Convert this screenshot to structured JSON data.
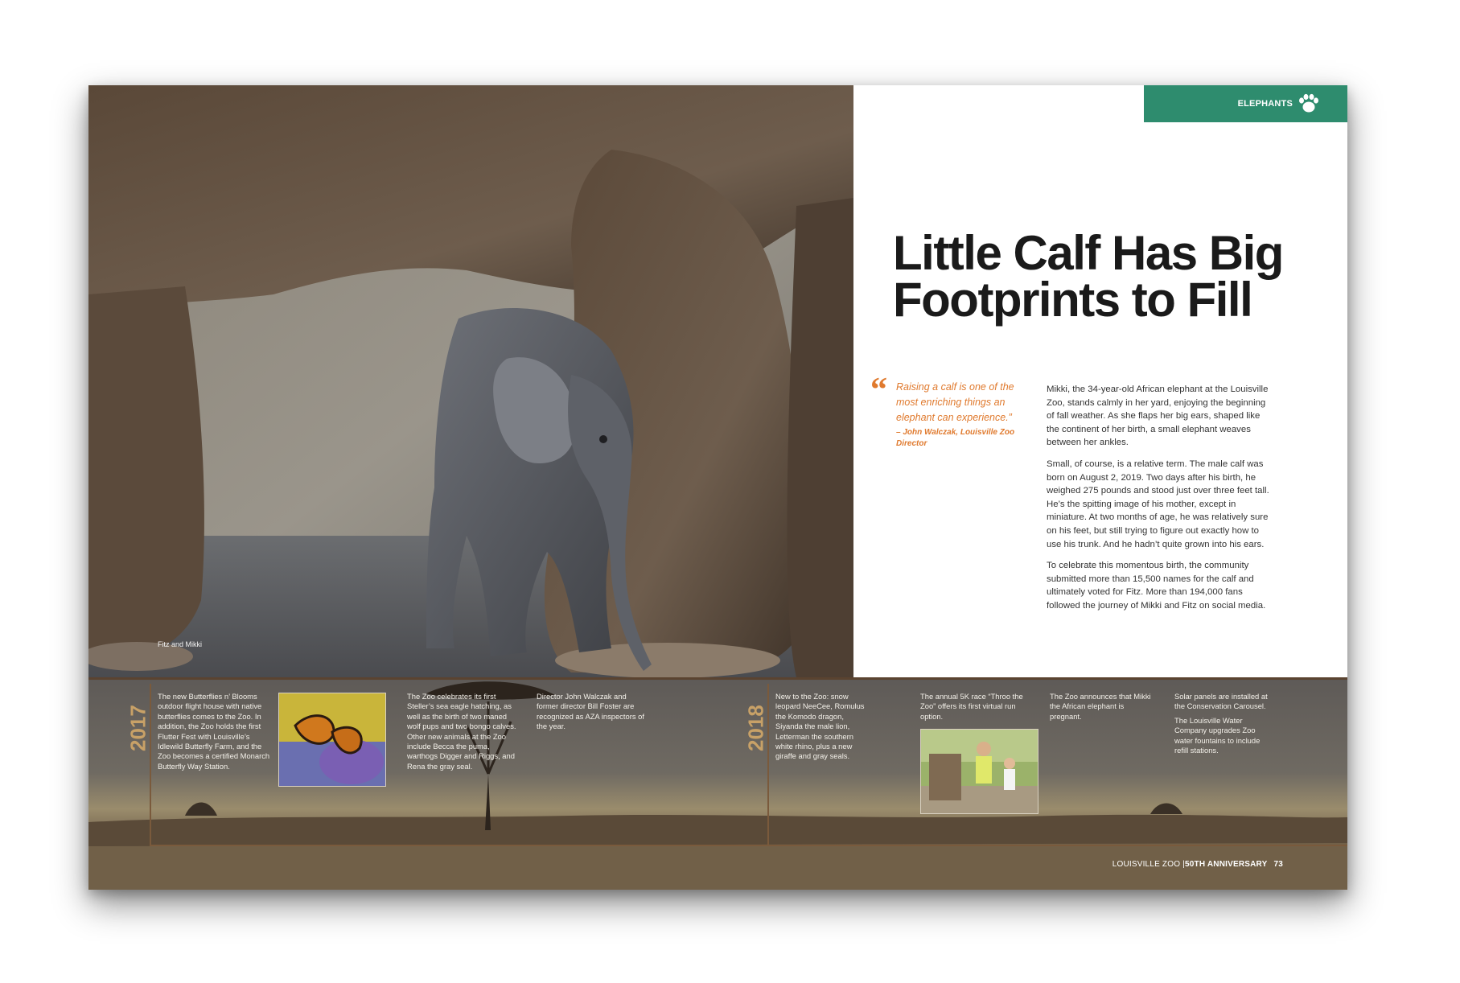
{
  "photo": {
    "caption": "Fitz and Mikki"
  },
  "section_tab": {
    "label": "ELEPHANTS",
    "icon": "paw-icon"
  },
  "headline": "Little Calf Has Big Footprints to Fill",
  "pull_quote": {
    "mark": "“",
    "text": "Raising a calf is one of the most enriching things an elephant can experience.”",
    "attribution": "– John Walczak, Louisville Zoo Director"
  },
  "body": [
    "Mikki, the 34-year-old African elephant at the Louisville Zoo, stands calmly in her yard, enjoying the beginning of fall weather. As she flaps her big ears, shaped like the continent of her birth, a small elephant weaves between her ankles.",
    "Small, of course, is a relative term. The male calf was born on August 2, 2019. Two days after his birth, he weighed 275 pounds and stood just over three feet tall. He’s the spitting image of his mother, except in miniature. At two months of age, he was relatively sure on his feet, but still trying to figure out exactly how to use his trunk. And he hadn’t quite grown into his ears.",
    "To celebrate this momentous birth, the community submitted more than 15,500 names for the calf and ultimately voted for Fitz. More than 194,000 fans followed the journey of Mikki and Fitz on social media."
  ],
  "timeline": {
    "year_2017": "2017",
    "year_2018": "2018",
    "entries_2017": [
      "The new Butterflies n’ Blooms outdoor flight house with native butterflies comes to the Zoo. In addition, the Zoo holds the first Flutter Fest with Louisville’s Idlewild Butterfly Farm, and the Zoo becomes a certified Monarch Butterfly Way Station.",
      "The Zoo celebrates its first Steller’s sea eagle hatching, as well as the birth of two maned wolf pups and two bongo calves. Other new animals at the Zoo include Becca the puma, warthogs Digger and Riggs, and Rena the gray seal.",
      "Director John Walczak and former director Bill Foster are recognized as AZA inspectors of the year."
    ],
    "entries_2018": [
      "New to the Zoo: snow leopard NeeCee, Romulus the Komodo dragon, Siyanda the male lion, Letterman the southern white rhino, plus a new giraffe and gray seals.",
      "The annual 5K race “Throo the Zoo” offers its first virtual run option.",
      "The Zoo announces that Mikki the African elephant is pregnant.",
      "Solar panels are installed at the Conservation Carousel.",
      "The Louisville Water Company upgrades Zoo water fountains to include refill stations."
    ]
  },
  "folio": {
    "publication": "LOUISVILLE ZOO |",
    "anniversary": "50TH ANNIVERSARY",
    "page": "73"
  }
}
